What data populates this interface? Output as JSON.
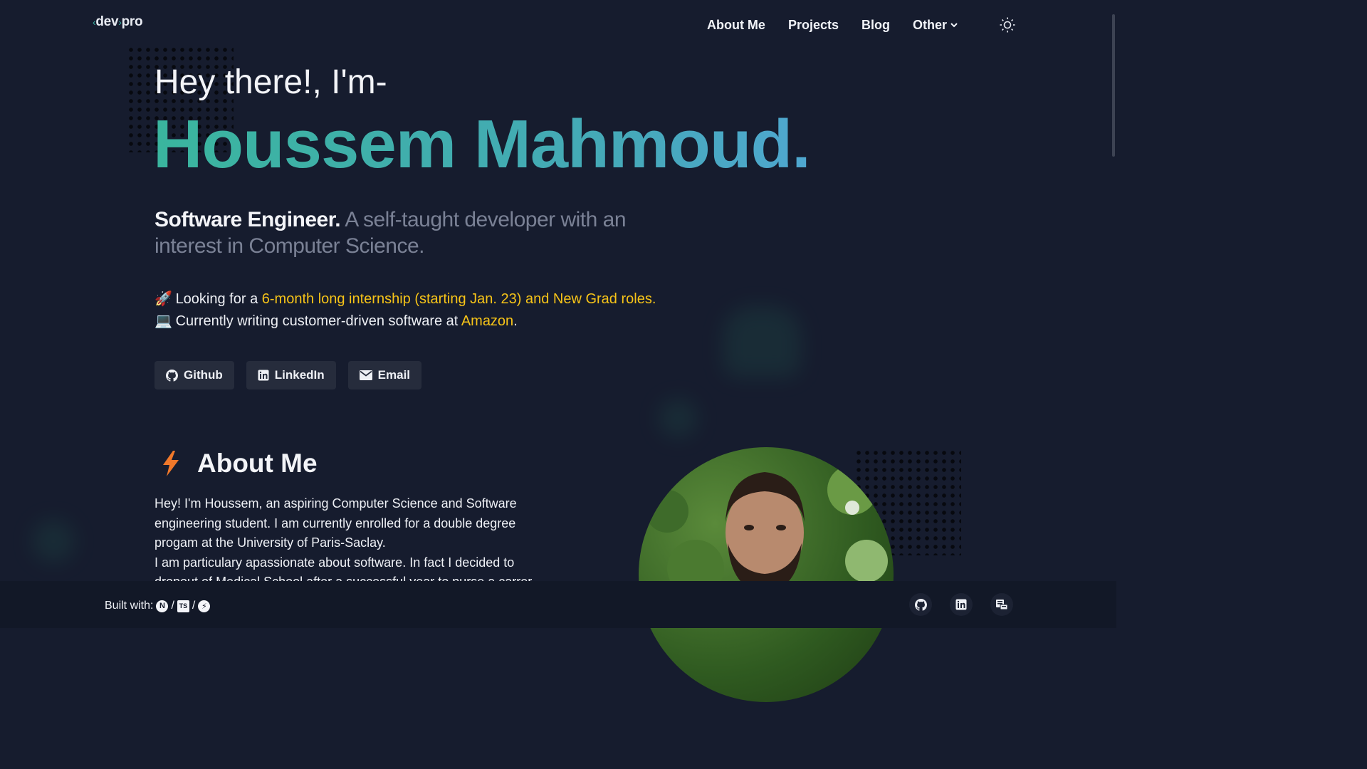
{
  "logo": {
    "left": "‹",
    "text": "dev",
    "mid": "›",
    "text2": "pro"
  },
  "nav": {
    "items": [
      "About Me",
      "Projects",
      "Blog",
      "Other"
    ],
    "other_icon": "chevron-down-icon",
    "theme_icon": "sun-icon"
  },
  "hero": {
    "greeting": "Hey there!, I'm-",
    "name": "Houssem Mahmoud.",
    "role": "Software Engineer.",
    "tagline": "A self-taught developer with an interest in Computer Science.",
    "line1_prefix": "Looking for a ",
    "line1_highlight": "6-month long internship (starting Jan. 23) and New Grad roles.",
    "line2_prefix": "Currently writing customer-driven software at ",
    "line2_highlight": "Amazon",
    "line2_suffix": ".",
    "emoji1": "🚀",
    "emoji2": "💻"
  },
  "buttons": [
    {
      "label": "Github",
      "icon": "github-icon"
    },
    {
      "label": "LinkedIn",
      "icon": "linkedin-icon"
    },
    {
      "label": "Email",
      "icon": "mail-icon"
    }
  ],
  "about": {
    "heading": "About Me",
    "icon": "lightning-icon",
    "p1": "Hey! I'm Houssem, an aspiring Computer Science and Software engineering student. I am currently enrolled for a double degree progam at the University of Paris-Saclay.",
    "p2": "I am particulary apassionate about software. In fact I decided to dropout of Medical School after a successful year to purse a carrer"
  },
  "footer": {
    "built_with": "Built with:",
    "sep": "/",
    "tech_icons": [
      "nextjs-icon",
      "typescript-icon",
      "bolt-icon"
    ],
    "social_icons": [
      "github-icon",
      "linkedin-icon",
      "blog-icon"
    ]
  },
  "colors": {
    "bg": "#161c2e",
    "accent_teal": "#3ab59e",
    "highlight": "#f7c418",
    "footer_bg": "#121827"
  }
}
